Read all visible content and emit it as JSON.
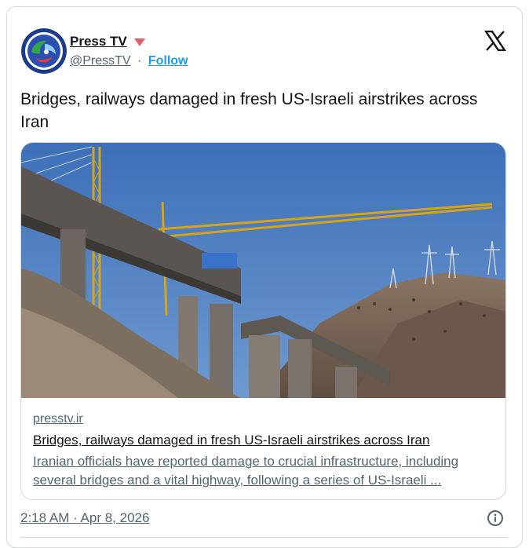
{
  "author": {
    "name": "Press TV",
    "handle": "@PressTV",
    "separator": "·",
    "follow_label": "Follow",
    "badge_color": "#e0245e"
  },
  "post": {
    "text": "Bridges, railways damaged in fresh US-Israeli airstrikes across Iran"
  },
  "link_card": {
    "domain": "presstv.ir",
    "title": "Bridges, railways damaged in fresh US-Israeli airstrikes across Iran",
    "description": "Iranian officials have reported damage to crucial infrastructure, including several bridges and a vital highway, following a series of US-Israeli ..."
  },
  "meta": {
    "timestamp": "2:18 AM · Apr 8, 2026"
  },
  "icons": {
    "platform": "x-logo-icon",
    "info": "info-icon"
  },
  "colors": {
    "accent": "#1d9bf0",
    "secondary_text": "#536471",
    "border": "#cfd9de"
  }
}
